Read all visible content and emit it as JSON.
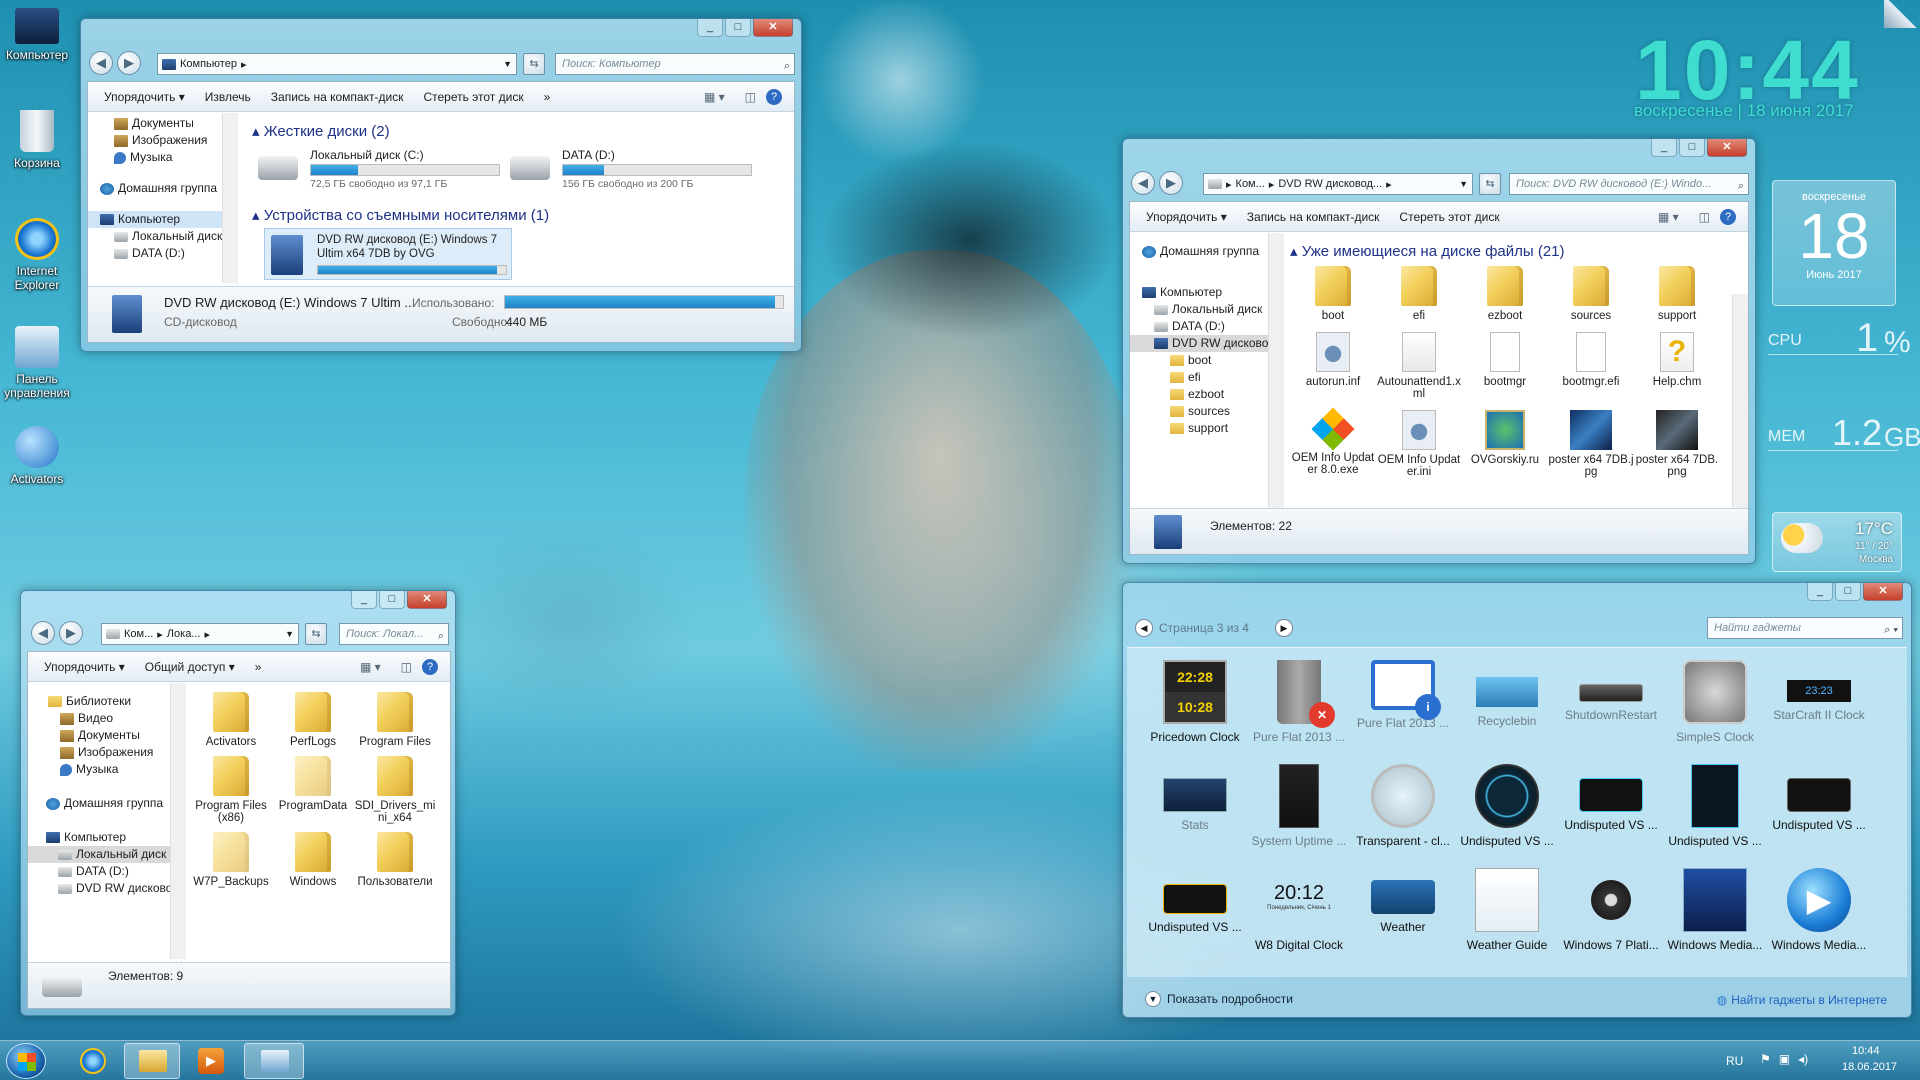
{
  "desktop": {
    "icons": [
      "Компьютер",
      "Корзина",
      "Internet Explorer",
      "Панель управления",
      "Activators"
    ]
  },
  "clock": {
    "time": "10:44",
    "date": "воскресенье | 18 июня 2017"
  },
  "calendar": {
    "weekday": "воскресенье",
    "day": "18",
    "month": "Июнь 2017"
  },
  "cpu": {
    "label": "CPU",
    "value": "1",
    "unit": "%"
  },
  "mem": {
    "label": "MEM",
    "value": "1.2",
    "unit": "GB"
  },
  "weather": {
    "temp": "17°C",
    "range": "11° / 20°",
    "city": "Москва"
  },
  "win1": {
    "address": "Компьютер",
    "search": "Поиск: Компьютер",
    "toolbar": [
      "Упорядочить ▾",
      "Извлечь",
      "Запись на компакт-диск",
      "Стереть этот диск",
      "»"
    ],
    "tree": [
      "Документы",
      "Изображения",
      "Музыка",
      "Домашняя группа",
      "Компьютер",
      "Локальный диск",
      "DATA (D:)"
    ],
    "group1": "Жесткие диски (2)",
    "driveC": {
      "name": "Локальный диск (C:)",
      "free": "72,5 ГБ свободно из 97,1 ГБ",
      "fill": 0.25
    },
    "driveD": {
      "name": "DATA (D:)",
      "free": "156 ГБ свободно из 200 ГБ",
      "fill": 0.22
    },
    "group2": "Устройства со съемными носителями (1)",
    "dvd": {
      "name": "DVD RW дисковод (E:) Windows 7 Ultim x64 7DB by OVG",
      "fill": 0.95
    },
    "details": {
      "name": "DVD RW дисковод (E:) Windows 7 Ultim ...",
      "type": "CD-дисковод",
      "used_label": "Использовано:",
      "free_label": "Свободно:",
      "free": "440 МБ",
      "fill": 0.97
    }
  },
  "win2": {
    "address": [
      "Ком...",
      "DVD RW дисковод..."
    ],
    "search": "Поиск: DVD RW дисковод (E:) Windo...",
    "toolbar": [
      "Упорядочить ▾",
      "Запись на компакт-диск",
      "Стереть этот диск"
    ],
    "tree": [
      "Домашняя группа",
      "Компьютер",
      "Локальный диск",
      "DATA (D:)",
      "DVD RW дисковод",
      "boot",
      "efi",
      "ezboot",
      "sources",
      "support"
    ],
    "group": "Уже имеющиеся на диске файлы (21)",
    "files": [
      "boot",
      "efi",
      "ezboot",
      "sources",
      "support",
      "autorun.inf",
      "Autounattend1.xml",
      "bootmgr",
      "bootmgr.efi",
      "Help.chm",
      "OEM Info Updater 8.0.exe",
      "OEM Info Updater.ini",
      "OVGorskiy.ru",
      "poster x64 7DB.jpg",
      "poster x64 7DB.png"
    ],
    "status": "Элементов: 22"
  },
  "win3": {
    "address": [
      "Ком...",
      "Лока..."
    ],
    "search": "Поиск: Локал...",
    "toolbar": [
      "Упорядочить ▾",
      "Общий доступ ▾",
      "»"
    ],
    "tree": [
      "Библиотеки",
      "Видео",
      "Документы",
      "Изображения",
      "Музыка",
      "Домашняя группа",
      "Компьютер",
      "Локальный диск",
      "DATA (D:)",
      "DVD RW дисковод"
    ],
    "files": [
      "Activators",
      "PerfLogs",
      "Program Files",
      "Program Files (x86)",
      "ProgramData",
      "SDI_Drivers_mini_x64",
      "W7P_Backups",
      "Windows",
      "Пользователи"
    ],
    "status": "Элементов: 9"
  },
  "gadgets": {
    "page": "Страница 3 из 4",
    "search": "Найти гаджеты",
    "items": [
      "Pricedown Clock",
      "Pure Flat 2013 ...",
      "Pure Flat 2013 ...",
      "Recyclebin",
      "ShutdownRestart",
      "SimpleS Clock",
      "StarCraft II Clock",
      "Stats",
      "System Uptime ...",
      "Transparent - cl...",
      "Undisputed VS ...",
      "Undisputed VS ...",
      "Undisputed VS ...",
      "Undisputed VS ...",
      "Undisputed VS ...",
      "W8 Digital Clock",
      "Weather",
      "Weather Guide",
      "Windows 7 Plati...",
      "Windows Media...",
      "Windows Media..."
    ],
    "clock_time": "20:12",
    "clock_sub": "Понедельник, Січень 1",
    "details": "Показать подробности",
    "online": "Найти гаджеты в Интернете"
  },
  "taskbar": {
    "lang": "RU",
    "time": "10:44",
    "date": "18.06.2017"
  }
}
